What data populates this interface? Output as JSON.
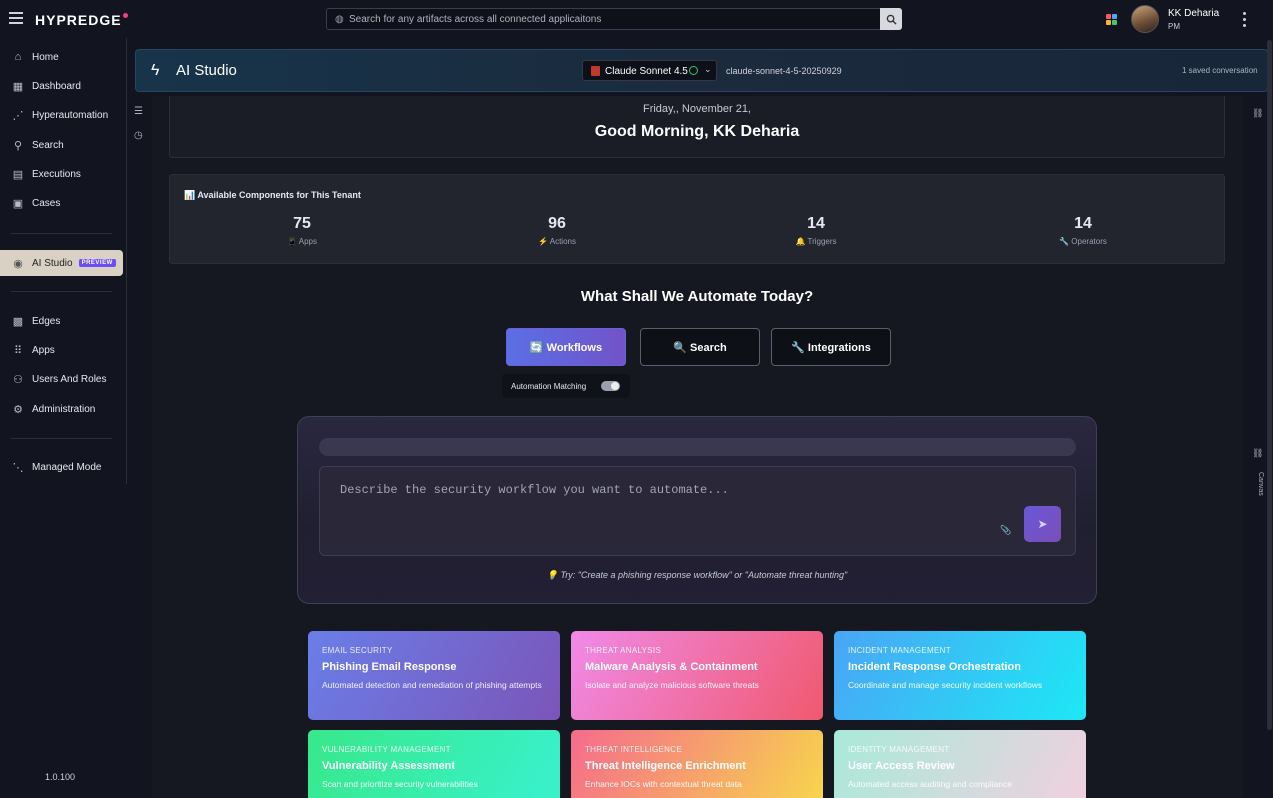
{
  "topbar": {
    "logo": "HYPREDGE",
    "search_placeholder": "Search for any artifacts across all connected applicaitons",
    "user_name": "KK Deharia",
    "user_role": "PM"
  },
  "sidebar": {
    "items": [
      {
        "label": "Home",
        "icon": "home-icon"
      },
      {
        "label": "Dashboard",
        "icon": "dashboard-icon"
      },
      {
        "label": "Hyperautomation",
        "icon": "hyperautomation-icon"
      },
      {
        "label": "Search",
        "icon": "search-icon"
      },
      {
        "label": "Executions",
        "icon": "executions-icon"
      },
      {
        "label": "Cases",
        "icon": "cases-icon"
      },
      {
        "label": "AI Studio",
        "icon": "ai-studio-icon",
        "badge": "PREVIEW",
        "active": true
      },
      {
        "label": "Edges",
        "icon": "edges-icon"
      },
      {
        "label": "Apps",
        "icon": "apps-icon"
      },
      {
        "label": "Users And Roles",
        "icon": "users-icon"
      },
      {
        "label": "Administration",
        "icon": "administration-icon"
      },
      {
        "label": "Managed Mode",
        "icon": "managed-mode-icon"
      }
    ],
    "version": "1.0.100"
  },
  "header": {
    "title": "AI Studio",
    "model_name": "Claude Sonnet 4.5",
    "model_id": "claude-sonnet-4-5-20250929",
    "saved": "1 saved conversation"
  },
  "greeting": {
    "date": "Friday,, November 21,",
    "text": "Good Morning, KK Deharia"
  },
  "components": {
    "title": "📊 Available Components for This Tenant",
    "stats": [
      {
        "num": "75",
        "label": "📱 Apps"
      },
      {
        "num": "96",
        "label": "⚡ Actions"
      },
      {
        "num": "14",
        "label": "🔔 Triggers"
      },
      {
        "num": "14",
        "label": "🔧 Operators"
      }
    ]
  },
  "automate": {
    "title": "What Shall We Automate Today?",
    "modes": [
      "🔄 Workflows",
      "🔍 Search",
      "🔧 Integrations"
    ],
    "toggle_label": "Automation Matching",
    "prompt_placeholder": "Describe the security workflow you want to automate...",
    "hint": "💡 Try: \"Create a phishing response workflow\" or \"Automate threat hunting\""
  },
  "templates": [
    {
      "category": "Email Security",
      "title": "Phishing Email Response",
      "desc": "Automated detection and remediation of phishing attempts"
    },
    {
      "category": "Threat Analysis",
      "title": "Malware Analysis & Containment",
      "desc": "Isolate and analyze malicious software threats"
    },
    {
      "category": "Incident Management",
      "title": "Incident Response Orchestration",
      "desc": "Coordinate and manage security incident workflows"
    },
    {
      "category": "Vulnerability Management",
      "title": "Vulnerability Assessment",
      "desc": "Scan and prioritize security vulnerabilities"
    },
    {
      "category": "Threat Intelligence",
      "title": "Threat Intelligence Enrichment",
      "desc": "Enhance IOCs with contextual threat data"
    },
    {
      "category": "Identity Management",
      "title": "User Access Review",
      "desc": "Automated access auditing and compliance"
    }
  ],
  "rightrail": {
    "canvas_label": "Canvas"
  },
  "colors": {
    "accent": "#6c4ef2",
    "brand_dot": "#ff3d7f"
  }
}
